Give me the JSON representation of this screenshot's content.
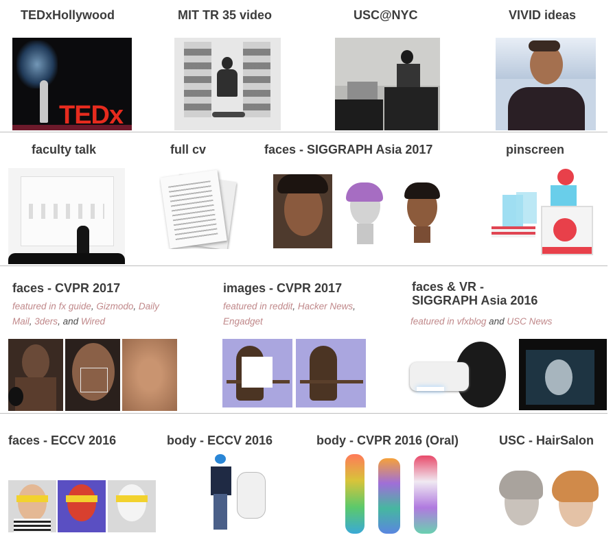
{
  "tiles": {
    "tedx": {
      "title": "TEDxHollywood",
      "logo": "TEDx"
    },
    "mit": {
      "title": "MIT TR 35 video"
    },
    "usc_nyc": {
      "title": "USC@NYC"
    },
    "vivid": {
      "title": "VIVID ideas"
    },
    "faculty": {
      "title": "faculty talk"
    },
    "cv": {
      "title": "full cv"
    },
    "faces_sa2017": {
      "title": "faces - SIGGRAPH Asia 2017"
    },
    "pinscreen": {
      "title": "pinscreen"
    },
    "faces_cvpr2017": {
      "title": "faces - CVPR 2017",
      "featured_prefix": "featured in",
      "links": [
        "fx guide",
        "Gizmodo",
        "Daily Mail",
        "3ders",
        "Wired"
      ],
      "and_word": "and"
    },
    "images_cvpr2017": {
      "title": "images - CVPR 2017",
      "featured_prefix": "featured in",
      "links": [
        "reddit",
        "Hacker News",
        "Engadget"
      ]
    },
    "faces_vr": {
      "title": "faces & VR -\nSIGGRAPH Asia 2016",
      "featured_prefix": "featured in",
      "links": [
        "vfxblog",
        "USC News"
      ],
      "and_word": "and"
    },
    "faces_eccv": {
      "title": "faces - ECCV 2016"
    },
    "body_eccv": {
      "title": "body - ECCV 2016"
    },
    "body_cvpr": {
      "title": "body - CVPR 2016 (Oral)"
    },
    "hairsalon": {
      "title": "USC - HairSalon"
    }
  },
  "colors": {
    "link": "#c0888a",
    "ted_red": "#e62b1e",
    "separator": "#bdbdbd"
  }
}
